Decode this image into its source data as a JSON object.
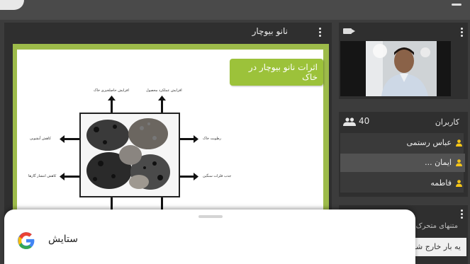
{
  "presentation": {
    "title": "نانو بیوچار"
  },
  "slide": {
    "title": "اثرات نانو بیوچار در خاک",
    "labels": {
      "top_left": "افزایش حاصلخیزی خاک",
      "top_right": "افزایش عملکرد محصول",
      "left_upper": "کاهش آبشویی",
      "left_lower": "کاهش انتشار گازها",
      "right_upper": "رطوبت خاک",
      "right_lower": "جذب فلزات سنگین"
    }
  },
  "users": {
    "count": "40",
    "title": "کاربران",
    "list": [
      {
        "name": "عباس رستمی"
      },
      {
        "name": "ایمان ..."
      },
      {
        "name": "فاطمه"
      }
    ]
  },
  "chat": {
    "top_text": "متنهای متحرک",
    "input_text": "یه بار خارج شو"
  },
  "sheet": {
    "text": "ستایش",
    "brand_color": "#4285F4"
  }
}
